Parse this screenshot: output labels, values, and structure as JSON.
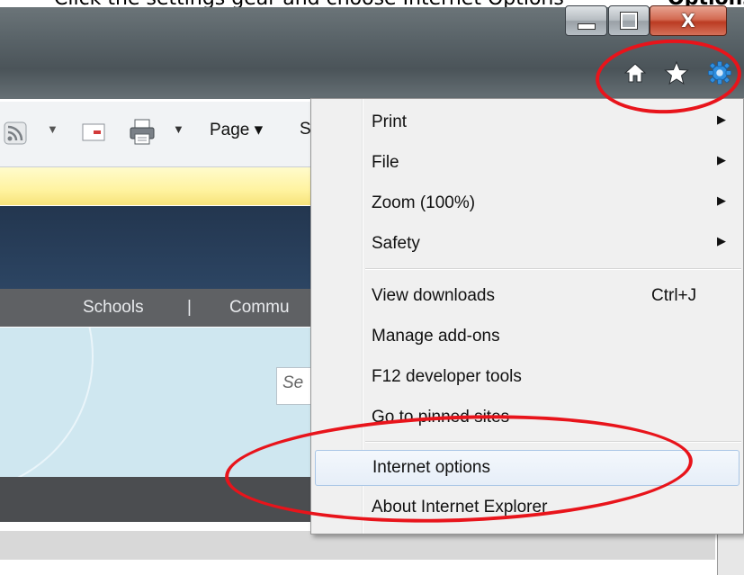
{
  "caption": {
    "text": "Click the settings gear and choose Internet Options",
    "bold": "Options"
  },
  "window": {
    "minimize_glyph": "",
    "maximize_glyph": "",
    "close_glyph": "X"
  },
  "command_bar": {
    "home_icon": "home-icon",
    "favorites_icon": "star-icon",
    "tools_icon": "gear-icon",
    "feed_icon": "rss-icon",
    "arrow1": "▼",
    "arrow2": "▼",
    "page_label": "Page ▾",
    "safety_partial": "S"
  },
  "page": {
    "nav_schools": "Schools",
    "nav_sep": "|",
    "nav_community_partial": "Commu",
    "search_partial": "Se"
  },
  "menu": {
    "items": [
      {
        "label": "Print",
        "shortcut": "",
        "submenu": "▶"
      },
      {
        "label": "File",
        "shortcut": "",
        "submenu": "▶"
      },
      {
        "label": "Zoom (100%)",
        "shortcut": "",
        "submenu": "▶"
      },
      {
        "label": "Safety",
        "shortcut": "",
        "submenu": "▶"
      },
      {
        "label": "View downloads",
        "shortcut": "Ctrl+J",
        "submenu": ""
      },
      {
        "label": "Manage add-ons",
        "shortcut": "",
        "submenu": ""
      },
      {
        "label": "F12 developer tools",
        "shortcut": "",
        "submenu": ""
      },
      {
        "label": "Go to pinned sites",
        "shortcut": "",
        "submenu": ""
      },
      {
        "label": "Internet options",
        "shortcut": "",
        "submenu": ""
      },
      {
        "label": "About Internet Explorer",
        "shortcut": "",
        "submenu": ""
      }
    ],
    "highlighted": "Internet options"
  },
  "colors": {
    "annotation": "#e8141b",
    "banner": "#23364f",
    "notify": "#fff3a0"
  }
}
